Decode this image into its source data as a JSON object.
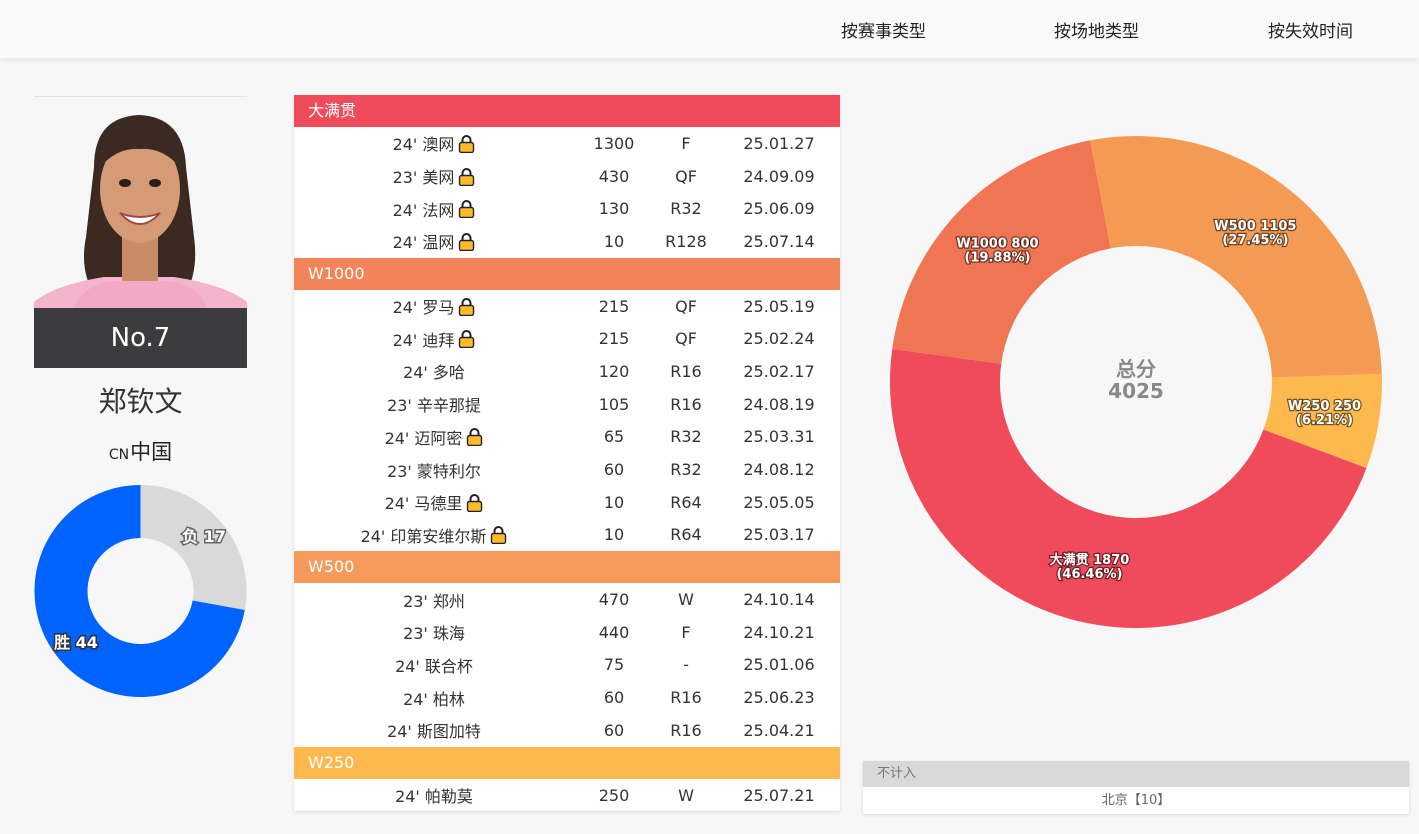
{
  "nav": {
    "tabs": [
      "按赛事类型",
      "按场地类型",
      "按失效时间"
    ]
  },
  "player": {
    "rank": "No.7",
    "name": "郑钦文",
    "country_code": "CN",
    "country": "中国",
    "wins_label": "胜 44",
    "losses_label": "负 17",
    "wins": 44,
    "losses": 17,
    "win_color": "#0062ff",
    "loss_color": "#d9d9d9"
  },
  "sections": [
    {
      "title": "大满贯",
      "color": "#ef4b5a",
      "rows": [
        {
          "name": "24' 澳网",
          "lock": true,
          "points": "1300",
          "round": "F",
          "expires": "25.01.27"
        },
        {
          "name": "23' 美网",
          "lock": true,
          "points": "430",
          "round": "QF",
          "expires": "24.09.09"
        },
        {
          "name": "24' 法网",
          "lock": true,
          "points": "130",
          "round": "R32",
          "expires": "25.06.09"
        },
        {
          "name": "24' 温网",
          "lock": true,
          "points": "10",
          "round": "R128",
          "expires": "25.07.14"
        }
      ]
    },
    {
      "title": "W1000",
      "color": "#f2845a",
      "rows": [
        {
          "name": "24' 罗马",
          "lock": true,
          "points": "215",
          "round": "QF",
          "expires": "25.05.19"
        },
        {
          "name": "24' 迪拜",
          "lock": true,
          "points": "215",
          "round": "QF",
          "expires": "25.02.24"
        },
        {
          "name": "24' 多哈",
          "lock": false,
          "points": "120",
          "round": "R16",
          "expires": "25.02.17"
        },
        {
          "name": "23' 辛辛那提",
          "lock": false,
          "points": "105",
          "round": "R16",
          "expires": "24.08.19"
        },
        {
          "name": "24' 迈阿密",
          "lock": true,
          "points": "65",
          "round": "R32",
          "expires": "25.03.31"
        },
        {
          "name": "23' 蒙特利尔",
          "lock": false,
          "points": "60",
          "round": "R32",
          "expires": "24.08.12"
        },
        {
          "name": "24' 马德里",
          "lock": true,
          "points": "10",
          "round": "R64",
          "expires": "25.05.05"
        },
        {
          "name": "24' 印第安维尔斯",
          "lock": true,
          "points": "10",
          "round": "R64",
          "expires": "25.03.17"
        }
      ]
    },
    {
      "title": "W500",
      "color": "#f59a5a",
      "rows": [
        {
          "name": "23' 郑州",
          "lock": false,
          "points": "470",
          "round": "W",
          "expires": "24.10.14"
        },
        {
          "name": "23' 珠海",
          "lock": false,
          "points": "440",
          "round": "F",
          "expires": "24.10.21"
        },
        {
          "name": "24' 联合杯",
          "lock": false,
          "points": "75",
          "round": "-",
          "expires": "25.01.06"
        },
        {
          "name": "24' 柏林",
          "lock": false,
          "points": "60",
          "round": "R16",
          "expires": "25.06.23"
        },
        {
          "name": "24' 斯图加特",
          "lock": false,
          "points": "60",
          "round": "R16",
          "expires": "25.04.21"
        }
      ]
    },
    {
      "title": "W250",
      "color": "#fdb94e",
      "rows": [
        {
          "name": "24' 帕勒莫",
          "lock": false,
          "points": "250",
          "round": "W",
          "expires": "25.07.21"
        }
      ]
    }
  ],
  "chart_data": {
    "type": "pie",
    "center_label": "总分",
    "center_value": "4025",
    "slices": [
      {
        "name": "W250",
        "value": 250,
        "pct": "6.21%",
        "label": "W250 250",
        "color": "#fdb94e"
      },
      {
        "name": "大满贯",
        "value": 1870,
        "pct": "46.46%",
        "label": "大满贯 1870",
        "color": "#ef4b5a"
      },
      {
        "name": "W1000",
        "value": 800,
        "pct": "19.88%",
        "label": "W1000 800",
        "color": "#f07552"
      },
      {
        "name": "W500",
        "value": 1105,
        "pct": "27.45%",
        "label": "W500 1105",
        "color": "#f59a52"
      }
    ]
  },
  "excluded": {
    "title": "不计入",
    "item": "北京【10】"
  }
}
